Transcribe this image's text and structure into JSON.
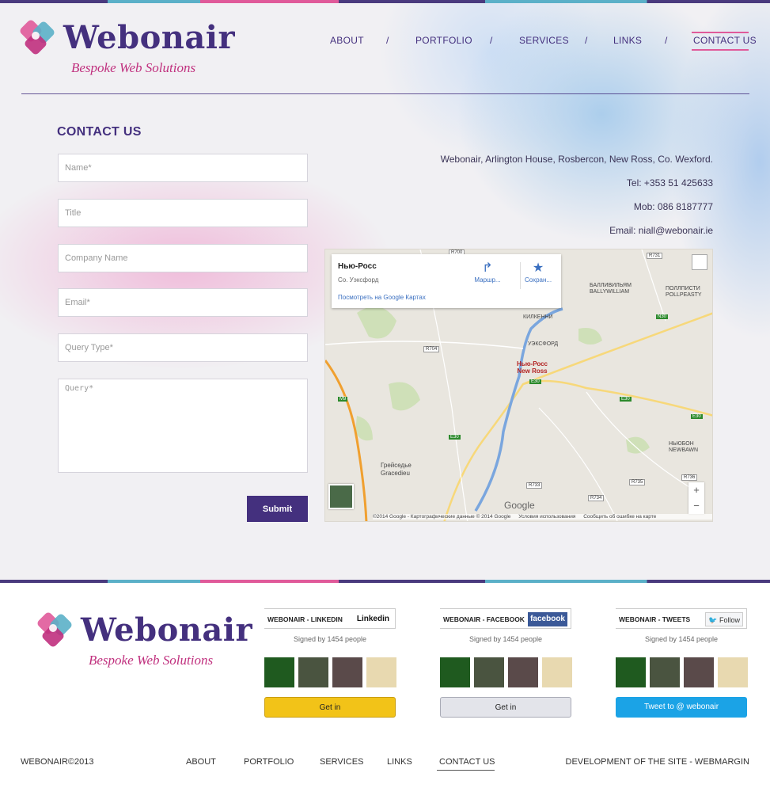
{
  "brand": {
    "name": "Webonair",
    "tagline": "Bespoke Web Solutions"
  },
  "nav": {
    "items": [
      "ABOUT",
      "PORTFOLIO",
      "SERVICES",
      "LINKS",
      "CONTACT US"
    ],
    "separator": "/",
    "active": "CONTACT US"
  },
  "page": {
    "title": "CONTACT US"
  },
  "form": {
    "name_placeholder": "Name*",
    "title_placeholder": "Title",
    "company_placeholder": "Company Name",
    "email_placeholder": "Email*",
    "query_type_placeholder": "Query Type*",
    "query_placeholder": "Query*",
    "submit_label": "Submit"
  },
  "contact": {
    "address": "Webonair, Arlington House, Rosbercon, New Ross, Co. Wexford.",
    "tel": "Tel: +353 51 425633",
    "mob": "Mob: 086 8187777",
    "email_label": "Email:",
    "email": "niall@webonair.ie"
  },
  "map": {
    "place": "Нью-Росс",
    "region": "Со. Уэксфорд",
    "view_link": "Посмотреть на Google Картах",
    "route_label": "Маршр...",
    "save_label": "Сохран...",
    "pin_label_ru": "Нью-Росс",
    "pin_label_en": "New Ross",
    "town_ru": "Грейседье",
    "town_en": "Gracedieu",
    "ballywilliam": "БАЛЛИВИЛЬЯМ",
    "ballywilliam_en": "BALLYWILLIAM",
    "pollpeasty": "ПОЛЛПИСТИ",
    "pollpeasty_en": "POLLPEASTY",
    "newbawn": "НЬЮБОН",
    "newbawn_en": "NEWBAWN",
    "kilkenny": "КИЛКЕННИ",
    "wexford": "УЭКСФОРД",
    "roads": [
      "R700",
      "R731",
      "N30",
      "R704",
      "E30",
      "M9",
      "R733",
      "R734",
      "R735",
      "R736"
    ],
    "google": "Google",
    "attribution": "©2014 Google - Картографические данные © 2014 Google",
    "terms": "Условия использования",
    "report": "Сообщить об ошибке на карте",
    "zoom_in": "+",
    "zoom_out": "−"
  },
  "widgets": [
    {
      "title": "WEBONAIR - LINKEDIN",
      "badge": "Linkedin",
      "signed": "Signed by 1454 people",
      "cta": "Get in",
      "cta_color": "#f2c318",
      "badge_color": "#0e76a8"
    },
    {
      "title": "WEBONAIR - FACEBOOK",
      "badge": "facebook",
      "signed": "Signed by 1454 people",
      "cta": "Get in",
      "cta_color": "#e3e4ea",
      "badge_color": "#3b5998"
    },
    {
      "title": "WEBONAIR - TWEETS",
      "badge": "Follow",
      "signed": "Signed by 1454 people",
      "cta": "Tweet to @ webonair",
      "cta_color": "#1ba3e6",
      "badge_color": "#55acee"
    }
  ],
  "footer": {
    "copyright": "WEBONAIR©2013",
    "nav": [
      "ABOUT",
      "PORTFOLIO",
      "SERVICES",
      "LINKS",
      "CONTACT US"
    ],
    "developer": "DEVELOPMENT OF THE SITE - WEBMARGIN"
  },
  "colors": {
    "brand_purple": "#44307e",
    "brand_pink": "#c0307e",
    "accent_teal": "#5bb0c8"
  }
}
